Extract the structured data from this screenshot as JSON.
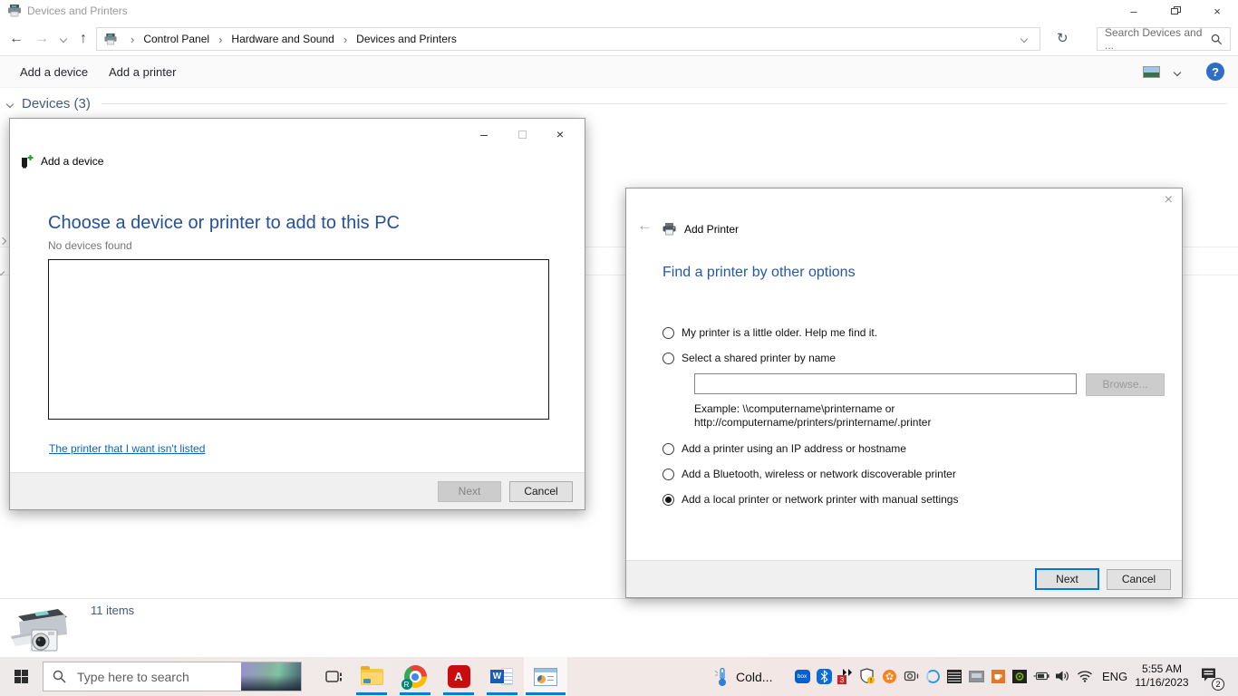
{
  "titlebar": {
    "title": "Devices and Printers"
  },
  "navbar": {
    "breadcrumb": [
      "Control Panel",
      "Hardware and Sound",
      "Devices and Printers"
    ],
    "search_placeholder": "Search Devices and ..."
  },
  "toolbar": {
    "add_device": "Add a device",
    "add_printer": "Add a printer"
  },
  "content": {
    "devices_header": "Devices (3)",
    "items_count": "11 items"
  },
  "add_device_dialog": {
    "title": "Add a device",
    "heading": "Choose a device or printer to add to this PC",
    "status": "No devices found",
    "link": "The printer that I want isn't listed",
    "next_label": "Next",
    "cancel_label": "Cancel"
  },
  "add_printer_dialog": {
    "title": "Add Printer",
    "heading": "Find a printer by other options",
    "options": [
      {
        "label": "My printer is a little older. Help me find it.",
        "selected": false
      },
      {
        "label": "Select a shared printer by name",
        "selected": false
      },
      {
        "label": "Add a printer using an IP address or hostname",
        "selected": false
      },
      {
        "label": "Add a Bluetooth, wireless or network discoverable printer",
        "selected": false
      },
      {
        "label": "Add a local printer or network printer with manual settings",
        "selected": true
      }
    ],
    "shared_name_value": "",
    "browse_label": "Browse...",
    "example_line1": "Example: \\\\computername\\printername or",
    "example_line2": "http://computername/printers/printername/.printer",
    "next_label": "Next",
    "cancel_label": "Cancel"
  },
  "taskbar": {
    "search_placeholder": "Type here to search",
    "weather": "Cold...",
    "language": "ENG",
    "time": "5:55 AM",
    "date": "11/16/2023",
    "notification_count": "2"
  },
  "icons": {
    "minimize": "–",
    "close": "×",
    "back": "←",
    "forward": "→",
    "up": "↑",
    "refresh": "↻",
    "breadcrumb_sep": "›",
    "help": "?",
    "box_label": "box",
    "update_badge": "3",
    "chrome_badge": "R",
    "acrobat_glyph": "A",
    "word_glyph": "W"
  }
}
